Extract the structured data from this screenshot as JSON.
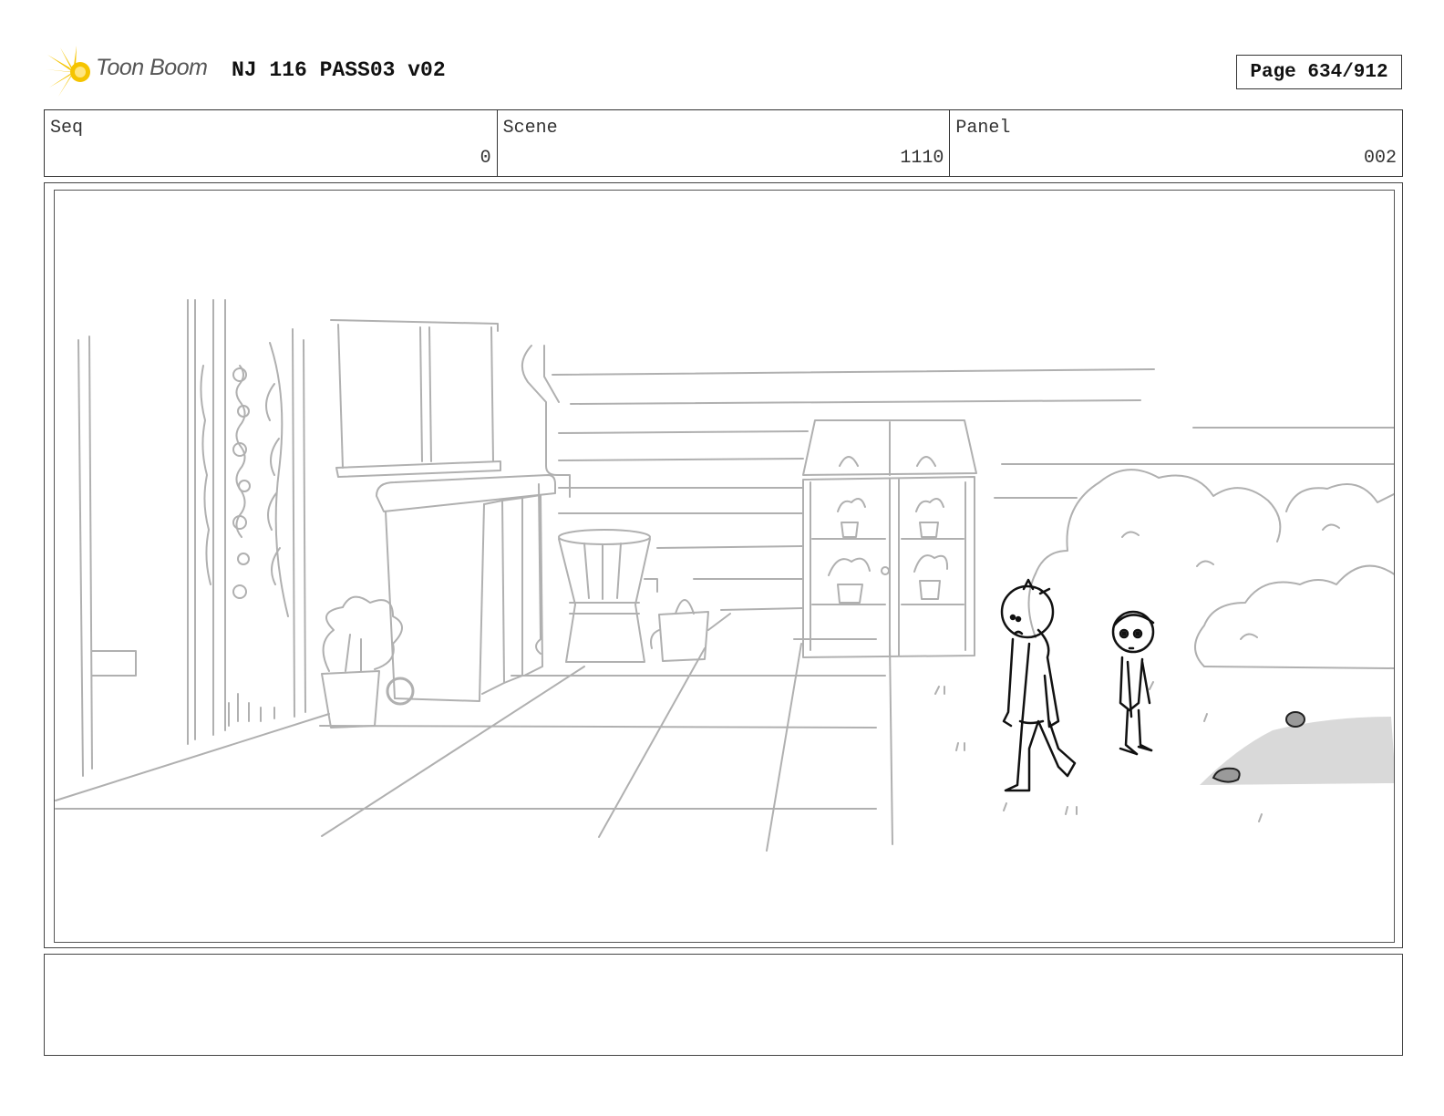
{
  "header": {
    "logo_text": "Toon Boom",
    "title": "NJ 116 PASS03 v02",
    "page_label": "Page 634/912"
  },
  "info": {
    "seq_label": "Seq",
    "seq_value": "0",
    "scene_label": "Scene",
    "scene_value": "1110",
    "panel_label": "Panel",
    "panel_value": "002"
  },
  "colors": {
    "logo_sun": "#f5c400",
    "sketch_line": "#b0b0b0",
    "character_line": "#111111",
    "ground_shadow": "#d9d9d9"
  },
  "caption": {
    "text": ""
  }
}
